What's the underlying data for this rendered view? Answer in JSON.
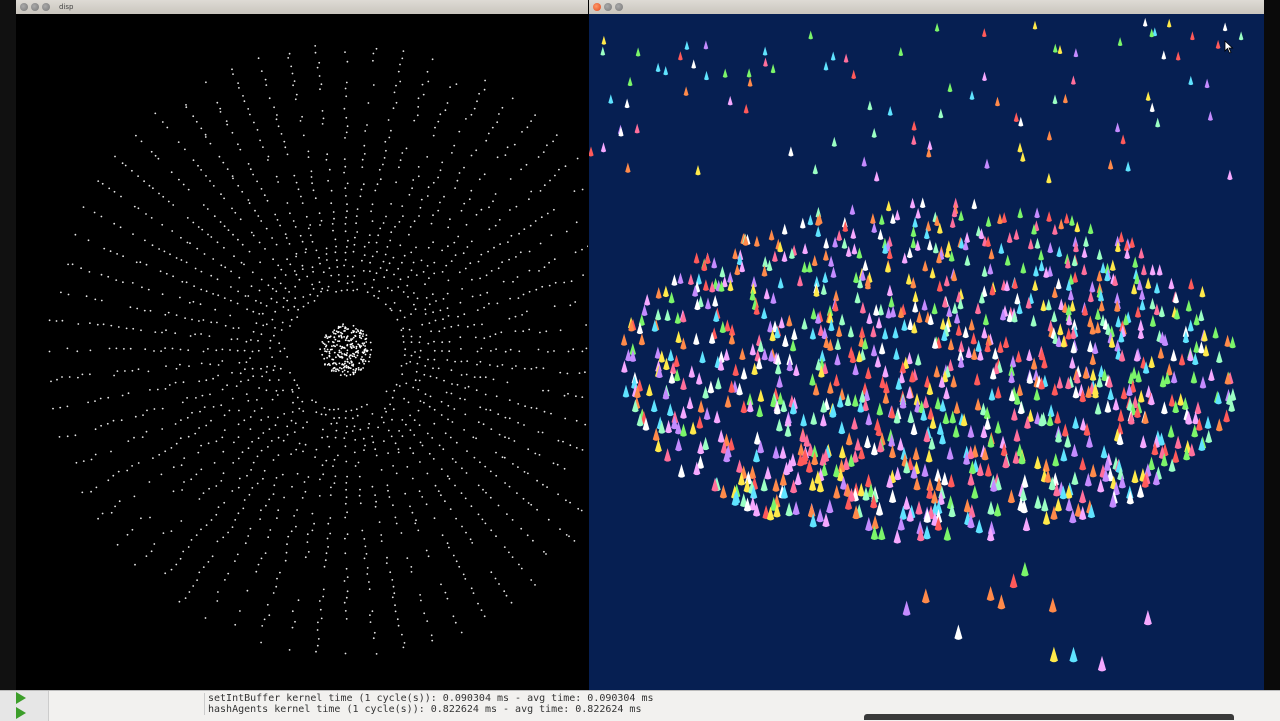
{
  "left_window": {
    "title": "disp",
    "canvas_description_icon": "particle-field"
  },
  "right_window": {
    "title": "",
    "background": "#061f52"
  },
  "terminal": {
    "partial_top": "...",
    "lines": [
      "setIntBuffer kernel time (1 cycle(s)): 0.090304 ms - avg time: 0.090304 ms",
      "hashAgents kernel time (1 cycle(s)): 0.822624 ms - avg time: 0.822624 ms"
    ]
  },
  "colors": {
    "accent_green": "#3c9e2a",
    "agent_palette": [
      "#ff6f9c",
      "#ffe94a",
      "#7bf56a",
      "#5fe3ff",
      "#ff8a4a",
      "#c48bff",
      "#ffffff",
      "#ff5a5a",
      "#9affc4",
      "#f5a8ff"
    ]
  }
}
